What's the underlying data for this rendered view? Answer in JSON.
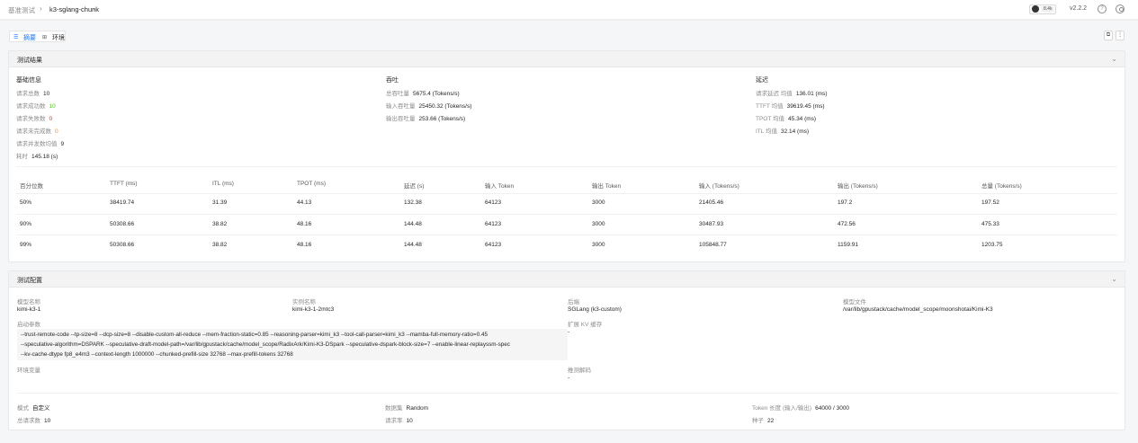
{
  "breadcrumb": {
    "parent": "基准测试",
    "current": "k3-sglang-chunk"
  },
  "header": {
    "github_count": "8.4k",
    "version": "v2.2.2",
    "help": "?"
  },
  "tabs": [
    {
      "label": "摘要",
      "icon": "list-icon"
    },
    {
      "label": "环境",
      "icon": "grid-icon"
    }
  ],
  "results": {
    "title": "测试结果",
    "basic": {
      "title": "基础信息",
      "items": [
        {
          "label": "请求总数",
          "value": "10"
        },
        {
          "label": "请求成功数",
          "value": "10"
        },
        {
          "label": "请求失败数",
          "value": "0"
        },
        {
          "label": "请求未完成数",
          "value": "0"
        },
        {
          "label": "请求并发数均值",
          "value": "9"
        },
        {
          "label": "耗时",
          "value": "145.18 (s)"
        }
      ]
    },
    "throughput": {
      "title": "吞吐",
      "items": [
        {
          "label": "总吞吐量",
          "value": "5675.4 (Tokens/s)"
        },
        {
          "label": "输入吞吐量",
          "value": "25450.32 (Tokens/s)"
        },
        {
          "label": "输出吞吐量",
          "value": "253.66 (Tokens/s)"
        }
      ]
    },
    "latency": {
      "title": "延迟",
      "items": [
        {
          "label": "请求延迟 均值",
          "value": "136.01 (ms)"
        },
        {
          "label": "TTFT 均值",
          "value": "39619.45 (ms)"
        },
        {
          "label": "TPOT 均值",
          "value": "45.34 (ms)"
        },
        {
          "label": "ITL 均值",
          "value": "32.14 (ms)"
        }
      ]
    },
    "table": {
      "headers": [
        "百分位数",
        "TTFT (ms)",
        "ITL (ms)",
        "TPOT (ms)",
        "延迟 (s)",
        "输入 Token",
        "输出 Token",
        "输入 (Tokens/s)",
        "输出 (Tokens/s)",
        "总量 (Tokens/s)"
      ],
      "rows": [
        [
          "50%",
          "38419.74",
          "31.39",
          "44.13",
          "132.38",
          "64123",
          "3000",
          "21405.46",
          "197.2",
          "197.52"
        ],
        [
          "90%",
          "50308.66",
          "38.82",
          "48.16",
          "144.48",
          "64123",
          "3000",
          "30487.93",
          "472.56",
          "475.33"
        ],
        [
          "99%",
          "50308.66",
          "38.82",
          "48.16",
          "144.48",
          "64123",
          "3000",
          "105848.77",
          "1159.91",
          "1203.75"
        ]
      ]
    }
  },
  "config": {
    "title": "测试配置",
    "model_name_label": "模型名称",
    "model_name": "kimi-k3-1",
    "instance_label": "实例名称",
    "instance": "kimi-k3-1-2mtc3",
    "backend_label": "后端",
    "backend": "SGLang (k3-custom)",
    "model_file_label": "模型文件",
    "model_file": "/var/lib/gpustack/cache/model_scope/moonshotai/Kimi-K3",
    "launch_params_label": "启动参数",
    "launch_params": [
      "--trust-remote-code  --tp-size=8  --dcp-size=8  --disable-custom-all-reduce  --mem-fraction-static=0.85  --reasoning-parser=kimi_k3  --tool-call-parser=kimi_k3  --mamba-full-memory-ratio=0.45",
      "--speculative-algorithm=DSPARK  --speculative-draft-model-path=/var/lib/gpustack/cache/model_scope/RadixArk/Kimi-K3-DSpark  --speculative-dspark-block-size=7  --enable-linear-replayssm-spec",
      "--kv-cache-dtype fp8_e4m3  --context-length 1000000  --chunked-prefill-size 32768  --max-prefill-tokens 32768"
    ],
    "extended_kv_label": "扩展 KV 缓存",
    "extended_kv": "-",
    "env_label": "环境变量",
    "spec_decode_label": "推测解码",
    "spec_decode": "-",
    "mode_label": "模式",
    "mode": "自定义",
    "dataset_label": "数据集",
    "dataset": "Random",
    "token_len_label": "Token 长度 (输入/输出)",
    "token_len": "64000 / 3000",
    "total_req_label": "总请求数",
    "total_req": "10",
    "req_rate_label": "请求率",
    "req_rate": "10",
    "seed_label": "种子",
    "seed": "22"
  }
}
